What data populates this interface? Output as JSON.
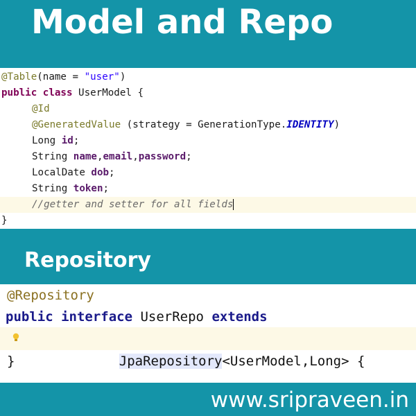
{
  "header": {
    "title": "Model and Repo"
  },
  "model_code": {
    "l1_ann": "@Table",
    "l1_open": "(name = ",
    "l1_str": "\"user\"",
    "l1_close": ")",
    "l2_kw1": "public",
    "l2_kw2": "class",
    "l2_rest": " UserModel {",
    "l3_ann": "@Id",
    "l4_ann": "@GeneratedValue",
    "l4_mid": " (strategy = GenerationType.",
    "l4_const": "IDENTITY",
    "l4_close": ")",
    "l5_type": "Long ",
    "l5_field": "id",
    "l5_end": ";",
    "l6_type": "String ",
    "l6_f1": "name",
    "l6_c1": ",",
    "l6_f2": "email",
    "l6_c2": ",",
    "l6_f3": "password",
    "l6_end": ";",
    "l7_type": "LocalDate ",
    "l7_field": "dob",
    "l7_end": ";",
    "l8_type": "String ",
    "l8_field": "token",
    "l8_end": ";",
    "l9_comment": "//getter and setter for all fields",
    "l10_brace": "}"
  },
  "section": {
    "label": "Repository"
  },
  "repo_code": {
    "l1_ann": "@Repository",
    "l2_kw1": "public",
    "l2_kw2": "interface",
    "l2_name": " UserRepo ",
    "l2_kw3": "extends",
    "l3_type": "JpaRepository",
    "l3_rest": "<UserModel,Long> {",
    "l4_brace": "}"
  },
  "footer": {
    "site": "www.sripraveen.in"
  },
  "colors": {
    "background": "#1494a8",
    "panel": "#ffffff",
    "highlight_line": "#fdf9e6",
    "keyword": "#7f0055",
    "annotation": "#7a7a2a"
  },
  "icons": {
    "hint": "lightbulb-icon"
  }
}
